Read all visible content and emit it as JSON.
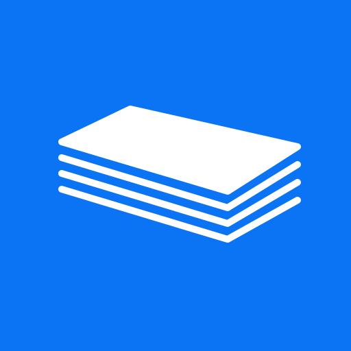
{
  "app_icon": {
    "icon": "paper-stack-icon",
    "background_color": "#0b74f5",
    "foreground_color": "#ffffff"
  }
}
